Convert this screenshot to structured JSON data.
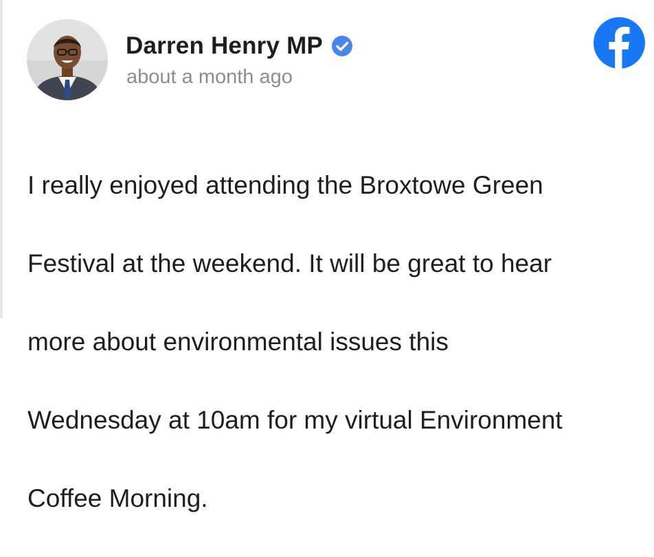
{
  "post": {
    "author": "Darren Henry MP",
    "timestamp": "about a month ago",
    "text_lines": [
      "I really enjoyed attending the Broxtowe Green",
      "Festival at the weekend. It will be great to hear",
      "more about environmental issues this",
      "Wednesday at 10am for my virtual Environment",
      "Coffee Morning."
    ]
  },
  "icons": {
    "avatar": "profile-photo",
    "verified": "verified-badge-icon",
    "platform": "facebook-logo-icon"
  },
  "colors": {
    "facebook_blue": "#1877f2",
    "verified_blue": "#4a86e8",
    "name_text": "#1c1e21",
    "meta_text": "#8a8d91"
  }
}
